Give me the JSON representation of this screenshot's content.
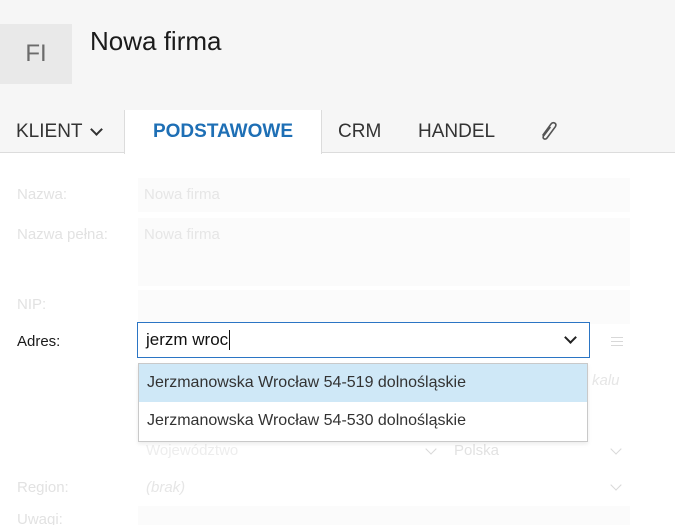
{
  "header": {
    "avatar_initials": "FI",
    "title": "Nowa firma"
  },
  "tabs": [
    {
      "label": "KLIENT",
      "has_dropdown": true
    },
    {
      "label": "PODSTAWOWE",
      "active": true
    },
    {
      "label": "CRM"
    },
    {
      "label": "HANDEL"
    }
  ],
  "icons": {
    "attachment": "paperclip-icon"
  },
  "form": {
    "nazwa": {
      "label": "Nazwa:",
      "value": "Nowa firma"
    },
    "nazwa_pelna": {
      "label": "Nazwa pełna:",
      "value": "Nowa firma"
    },
    "nip": {
      "label": "NIP:"
    },
    "adres": {
      "label": "Adres:",
      "value": "jerzm wroc"
    },
    "lokal_hint": "kalu",
    "wojewodztwo_placeholder": "Województwo",
    "kraj": "Polska",
    "region": {
      "label": "Region:",
      "value": "(brak)"
    },
    "uwagi": {
      "label": "Uwagi:"
    }
  },
  "address_suggestions": [
    {
      "text": "Jerzmanowska Wrocław 54-519 dolnośląskie",
      "highlighted": true
    },
    {
      "text": "Jerzmanowska Wrocław 54-530 dolnośląskie",
      "highlighted": false
    }
  ],
  "colors": {
    "accent": "#1e6fb5",
    "highlight": "#cfe8f7",
    "input_border": "#2b75c4"
  }
}
